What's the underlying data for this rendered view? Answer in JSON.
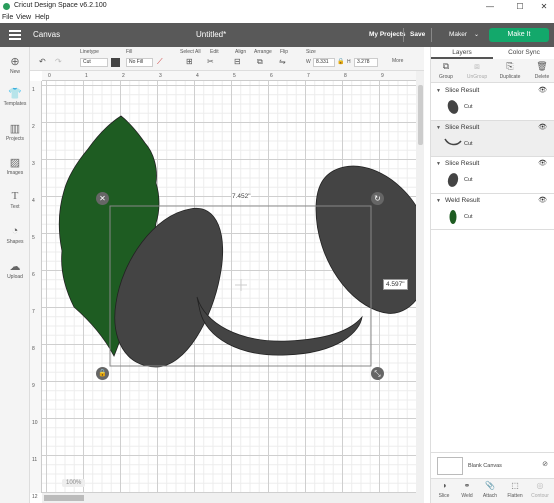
{
  "window": {
    "title": "Cricut Design Space  v6.2.100",
    "minimize": "—",
    "maximize": "☐",
    "close": "✕"
  },
  "menu": [
    "File",
    "View",
    "Help"
  ],
  "header": {
    "canvas_label": "Canvas",
    "doc_title": "Untitled*",
    "my_projects": "My Projects",
    "save": "Save",
    "machine": "Maker",
    "make_it": "Make It"
  },
  "toolbar": {
    "linetype": {
      "label": "Linetype",
      "value": "Cut"
    },
    "fill": {
      "label": "Fill",
      "value": "No Fill"
    },
    "select_all": "Select All",
    "edit": "Edit",
    "align": "Align",
    "arrange": "Arrange",
    "flip": "Flip",
    "size": {
      "label": "Size",
      "w_label": "W",
      "w_value": "8.331",
      "h_label": "H",
      "h_value": "3.278"
    },
    "more": "More"
  },
  "sidebar": [
    {
      "label": "New",
      "icon": "plus-icon"
    },
    {
      "label": "Templates",
      "icon": "shirt-icon"
    },
    {
      "label": "Projects",
      "icon": "projects-icon"
    },
    {
      "label": "Images",
      "icon": "image-icon"
    },
    {
      "label": "Text",
      "icon": "text-icon"
    },
    {
      "label": "Shapes",
      "icon": "shapes-icon"
    },
    {
      "label": "Upload",
      "icon": "upload-icon"
    }
  ],
  "ruler": {
    "top": [
      "0",
      "1",
      "2",
      "3",
      "4",
      "5",
      "6",
      "7",
      "8",
      "9",
      "10"
    ],
    "left": [
      "1",
      "2",
      "3",
      "4",
      "5",
      "6",
      "7",
      "8",
      "9",
      "10",
      "11",
      "12"
    ]
  },
  "canvas": {
    "width_label": "7.452\"",
    "height_label": "4.597\"",
    "zoom": "100%",
    "colors": {
      "green": "#1e5c22",
      "grey": "#444444"
    }
  },
  "panel": {
    "tabs": [
      "Layers",
      "Color Sync"
    ],
    "tools": [
      "Group",
      "UnGroup",
      "Duplicate",
      "Delete"
    ],
    "layers": [
      {
        "name": "Slice Result",
        "sub": "Cut"
      },
      {
        "name": "Slice Result",
        "sub": "Cut"
      },
      {
        "name": "Slice Result",
        "sub": "Cut"
      },
      {
        "name": "Weld Result",
        "sub": "Cut"
      }
    ],
    "blank_canvas": "Blank Canvas",
    "bottom_tools": [
      "Slice",
      "Weld",
      "Attach",
      "Flatten",
      "Contour"
    ]
  }
}
